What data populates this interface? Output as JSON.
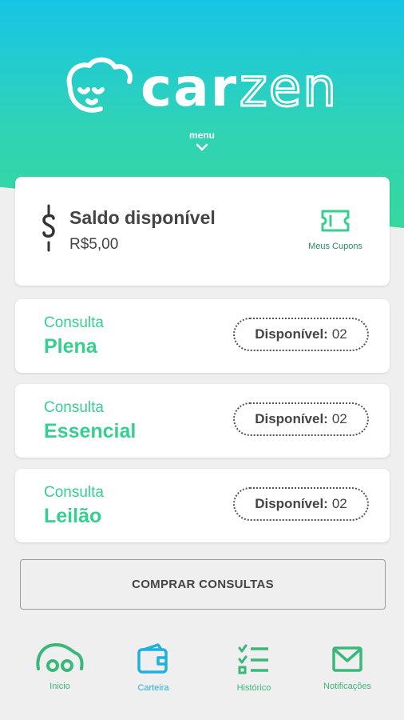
{
  "app": {
    "name": "carzen"
  },
  "header": {
    "menu_label": "menu"
  },
  "balance": {
    "title": "Saldo disponível",
    "value": "R$5,00",
    "coupons_label": "Meus Cupons"
  },
  "consultas": [
    {
      "label": "Consulta",
      "name": "Plena",
      "available_label": "Disponível:",
      "available_count": "02"
    },
    {
      "label": "Consulta",
      "name": "Essencial",
      "available_label": "Disponível:",
      "available_count": "02"
    },
    {
      "label": "Consulta",
      "name": "Leilão",
      "available_label": "Disponível:",
      "available_count": "02"
    }
  ],
  "buy_button": "COMPRAR CONSULTAS",
  "nav": [
    {
      "label": "Inicio",
      "icon": "car-icon",
      "active": false
    },
    {
      "label": "Carteira",
      "icon": "wallet-icon",
      "active": true
    },
    {
      "label": "Histórico",
      "icon": "checklist-icon",
      "active": false
    },
    {
      "label": "Notificações",
      "icon": "mail-icon",
      "active": false
    }
  ],
  "colors": {
    "accent_green": "#35d08f",
    "active_blue": "#1fb0dd",
    "header_top": "#16c5e6",
    "header_bottom": "#36d89d"
  }
}
